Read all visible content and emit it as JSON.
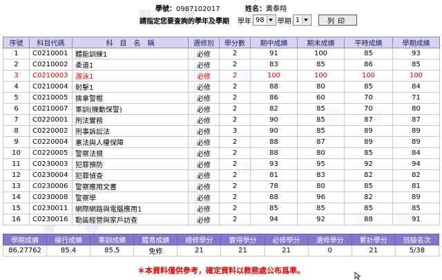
{
  "student": {
    "id_label": "學號：",
    "id_value": "0987102017",
    "name_label": "姓名：",
    "name_value": "黃泰翔"
  },
  "query": {
    "prompt": "請指定您要查詢的學年及學期",
    "year_label": "學年",
    "year_value": "98",
    "semester_label": "學期",
    "semester_value": "1",
    "print_label": "列印"
  },
  "watermark": "警專",
  "columns": [
    "序號",
    "科目代碼",
    "科　目　名　稱",
    "選修別",
    "學分數",
    "期中成績",
    "期末成績",
    "平時成績",
    "學期成績"
  ],
  "rows": [
    {
      "no": "1",
      "code": "C0210001",
      "name": "體能訓練1",
      "type": "必修",
      "credits": "2",
      "mid": "91",
      "final": "100",
      "usual": "85",
      "term": "93"
    },
    {
      "no": "2",
      "code": "C0210002",
      "name": "柔道1",
      "type": "必修",
      "credits": "2",
      "mid": "83",
      "final": "85",
      "usual": "86",
      "term": "85"
    },
    {
      "no": "3",
      "code": "C0210003",
      "name": "游泳1",
      "type": "必修",
      "credits": "2",
      "mid": "100",
      "final": "100",
      "usual": "100",
      "term": "100"
    },
    {
      "no": "4",
      "code": "C0210004",
      "name": "射擊1",
      "type": "必修",
      "credits": "2",
      "mid": "88",
      "final": "80",
      "usual": "85",
      "term": "84"
    },
    {
      "no": "5",
      "code": "C0210005",
      "name": "擒拿警棍",
      "type": "必修",
      "credits": "2",
      "mid": "86",
      "final": "60",
      "usual": "70",
      "term": "71"
    },
    {
      "no": "6",
      "code": "C0210007",
      "name": "軍訓(機動保警)",
      "type": "必修",
      "credits": "2",
      "mid": "82",
      "final": "85",
      "usual": "70",
      "term": "80"
    },
    {
      "no": "7",
      "code": "C0220001",
      "name": "刑法實務",
      "type": "必修",
      "credits": "2",
      "mid": "90",
      "final": "85",
      "usual": "87",
      "term": "87"
    },
    {
      "no": "8",
      "code": "C0220002",
      "name": "刑事訴訟法",
      "type": "必修",
      "credits": "3",
      "mid": "90",
      "final": "85",
      "usual": "89",
      "term": "89"
    },
    {
      "no": "9",
      "code": "C0220004",
      "name": "憲法與人權保障",
      "type": "必修",
      "credits": "2",
      "mid": "88",
      "final": "87",
      "usual": "89",
      "term": "89"
    },
    {
      "no": "10",
      "code": "C0220005",
      "name": "警察法規",
      "type": "必修",
      "credits": "2",
      "mid": "88",
      "final": "80",
      "usual": "85",
      "term": "84"
    },
    {
      "no": "11",
      "code": "C0230003",
      "name": "犯罪預防",
      "type": "必修",
      "credits": "2",
      "mid": "93",
      "final": "95",
      "usual": "92",
      "term": "94"
    },
    {
      "no": "12",
      "code": "C0230004",
      "name": "犯罪偵查",
      "type": "必修",
      "credits": "2",
      "mid": "81",
      "final": "83",
      "usual": "82",
      "term": "82"
    },
    {
      "no": "13",
      "code": "C0230006",
      "name": "警察應用文書",
      "type": "必修",
      "credits": "2",
      "mid": "78",
      "final": "80",
      "usual": "85",
      "term": "81"
    },
    {
      "no": "14",
      "code": "C0230008",
      "name": "警察學",
      "type": "必修",
      "credits": "2",
      "mid": "88",
      "final": "96",
      "usual": "82",
      "term": "89"
    },
    {
      "no": "15",
      "code": "C0230011",
      "name": "網際網路與電腦應用1",
      "type": "必修",
      "credits": "2",
      "mid": "85",
      "final": "85",
      "usual": "85",
      "term": "85"
    },
    {
      "no": "16",
      "code": "C0230016",
      "name": "勤區經營與家戶訪查",
      "type": "必修",
      "credits": "2",
      "mid": "94",
      "final": "92",
      "usual": "88",
      "term": "91"
    }
  ],
  "highlight_color": "#e60000",
  "summary": {
    "headers": [
      "學期成績",
      "操行成績",
      "軍訓成績",
      "體育成績",
      "總修學分",
      "實得學分",
      "必修學分",
      "選修學分",
      "累計學分",
      "班級名次"
    ],
    "values": [
      "86.27762",
      "85.4",
      "85.5",
      "免修",
      "21",
      "21",
      "21",
      "0",
      "21",
      "5/38"
    ]
  },
  "notice": "＊本資料僅供參考，確定資料以教務處公布爲準。"
}
